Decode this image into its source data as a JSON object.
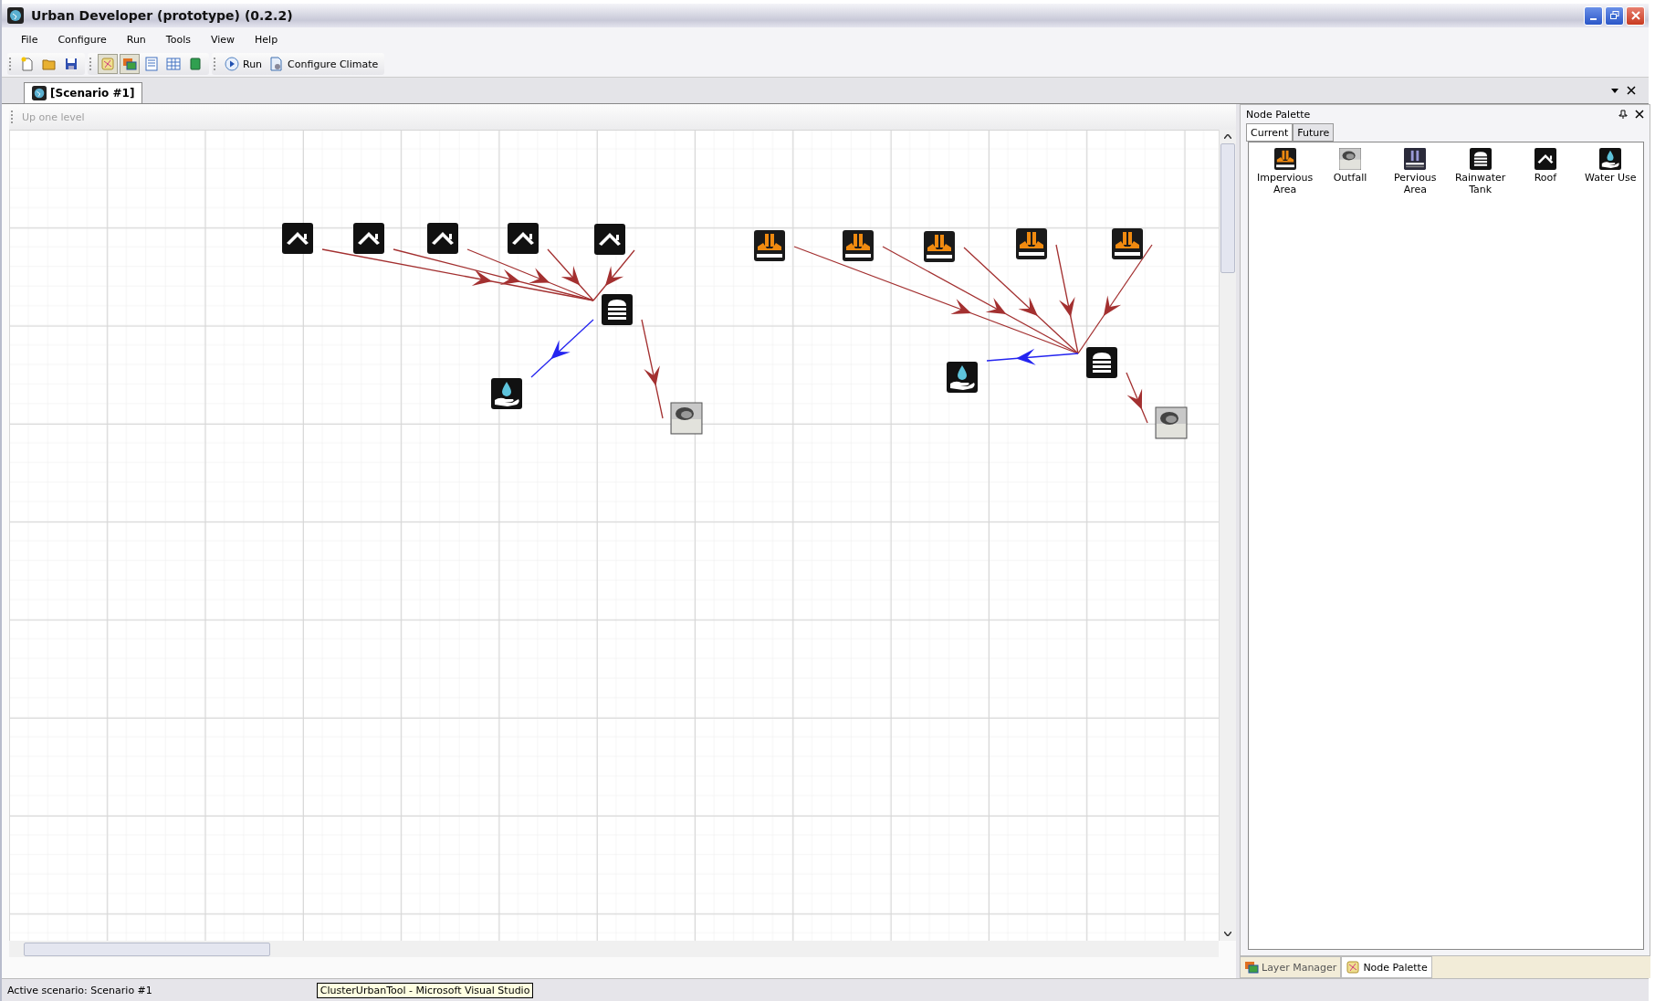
{
  "window": {
    "title": "Urban Developer (prototype) (0.2.2)"
  },
  "menu": [
    "File",
    "Configure",
    "Run",
    "Tools",
    "View",
    "Help"
  ],
  "toolbar": {
    "file_tools": [
      {
        "kind": "new"
      },
      {
        "kind": "open"
      },
      {
        "kind": "save"
      }
    ],
    "view_toggles": [
      {
        "kind": "layers",
        "selected": true
      },
      {
        "kind": "palette",
        "selected": true
      },
      {
        "kind": "list",
        "selected": false
      },
      {
        "kind": "table",
        "selected": false
      },
      {
        "kind": "book",
        "selected": false
      }
    ],
    "actions": [
      {
        "kind": "run",
        "label": "Run"
      },
      {
        "kind": "climate",
        "label": "Configure Climate"
      }
    ]
  },
  "document_tabs": [
    {
      "label": "[Scenario #1]",
      "selected": true
    }
  ],
  "canvas_toolbar": {
    "label": "Up one level",
    "disabled": true
  },
  "diagram": {
    "nodes": [
      {
        "kind": "roof"
      },
      {
        "kind": "roof"
      },
      {
        "kind": "roof"
      },
      {
        "kind": "roof"
      },
      {
        "kind": "roof"
      },
      {
        "kind": "tank"
      },
      {
        "kind": "water_use"
      },
      {
        "kind": "outfall"
      },
      {
        "kind": "impervious"
      },
      {
        "kind": "impervious"
      },
      {
        "kind": "impervious"
      },
      {
        "kind": "impervious"
      },
      {
        "kind": "impervious"
      },
      {
        "kind": "tank"
      },
      {
        "kind": "water_use"
      },
      {
        "kind": "outfall"
      }
    ],
    "connections": [
      {
        "kind": "runoff"
      },
      {
        "kind": "runoff"
      },
      {
        "kind": "runoff"
      },
      {
        "kind": "runoff"
      },
      {
        "kind": "runoff"
      },
      {
        "kind": "supply"
      },
      {
        "kind": "runoff"
      },
      {
        "kind": "runoff"
      },
      {
        "kind": "runoff"
      },
      {
        "kind": "runoff"
      },
      {
        "kind": "runoff"
      },
      {
        "kind": "runoff"
      },
      {
        "kind": "supply"
      },
      {
        "kind": "runoff"
      }
    ]
  },
  "palette": {
    "title": "Node Palette",
    "tabs": [
      {
        "label": "Current",
        "selected": true
      },
      {
        "label": "Future",
        "selected": false
      }
    ],
    "items": [
      {
        "kind": "impervious",
        "label": "Impervious Area"
      },
      {
        "kind": "outfall",
        "label": "Outfall"
      },
      {
        "kind": "pervious",
        "label": "Pervious Area"
      },
      {
        "kind": "tank",
        "label": "Rainwater Tank"
      },
      {
        "kind": "roof",
        "label": "Roof"
      },
      {
        "kind": "water_use",
        "label": "Water Use"
      }
    ]
  },
  "panel_tabs": [
    {
      "label": "Layer Manager",
      "selected": false
    },
    {
      "label": "Node Palette",
      "selected": true
    }
  ],
  "status_bar": {
    "text": "Active scenario: Scenario #1"
  },
  "tooltip": {
    "text": "ClusterUrbanTool - Microsoft Visual Studio"
  }
}
